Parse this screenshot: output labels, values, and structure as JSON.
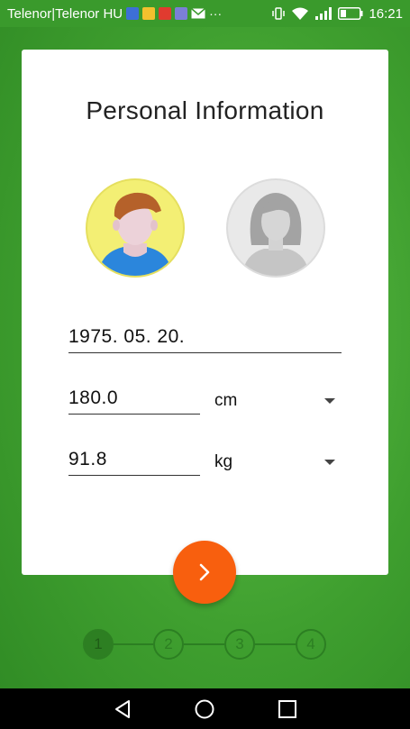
{
  "status_bar": {
    "carrier": "Telenor|Telenor HU",
    "time": "16:21",
    "notification_icons": [
      "calendar-icon",
      "notes-icon",
      "youtube-icon",
      "gallery-icon",
      "mail-icon",
      "more-icon"
    ],
    "status_icons": [
      "vibrate-icon",
      "wifi-icon",
      "signal-icon",
      "battery-icon"
    ]
  },
  "card": {
    "title": "Personal Information",
    "gender": {
      "options": [
        "male",
        "female"
      ],
      "selected": "male",
      "colors": {
        "male_bg": "#f3ef74",
        "female_bg": "#e9e9e9"
      }
    },
    "birth_date": {
      "value": "1975. 05. 20."
    },
    "height": {
      "value": "180.0",
      "unit": "cm"
    },
    "weight": {
      "value": "91.8",
      "unit": "kg"
    }
  },
  "next_button": {
    "icon": "chevron-right-icon",
    "color": "#f85f0e"
  },
  "stepper": {
    "steps": [
      "1",
      "2",
      "3",
      "4"
    ],
    "current": 1
  },
  "nav_bar": {
    "buttons": [
      "back-icon",
      "home-icon",
      "recents-icon"
    ]
  }
}
